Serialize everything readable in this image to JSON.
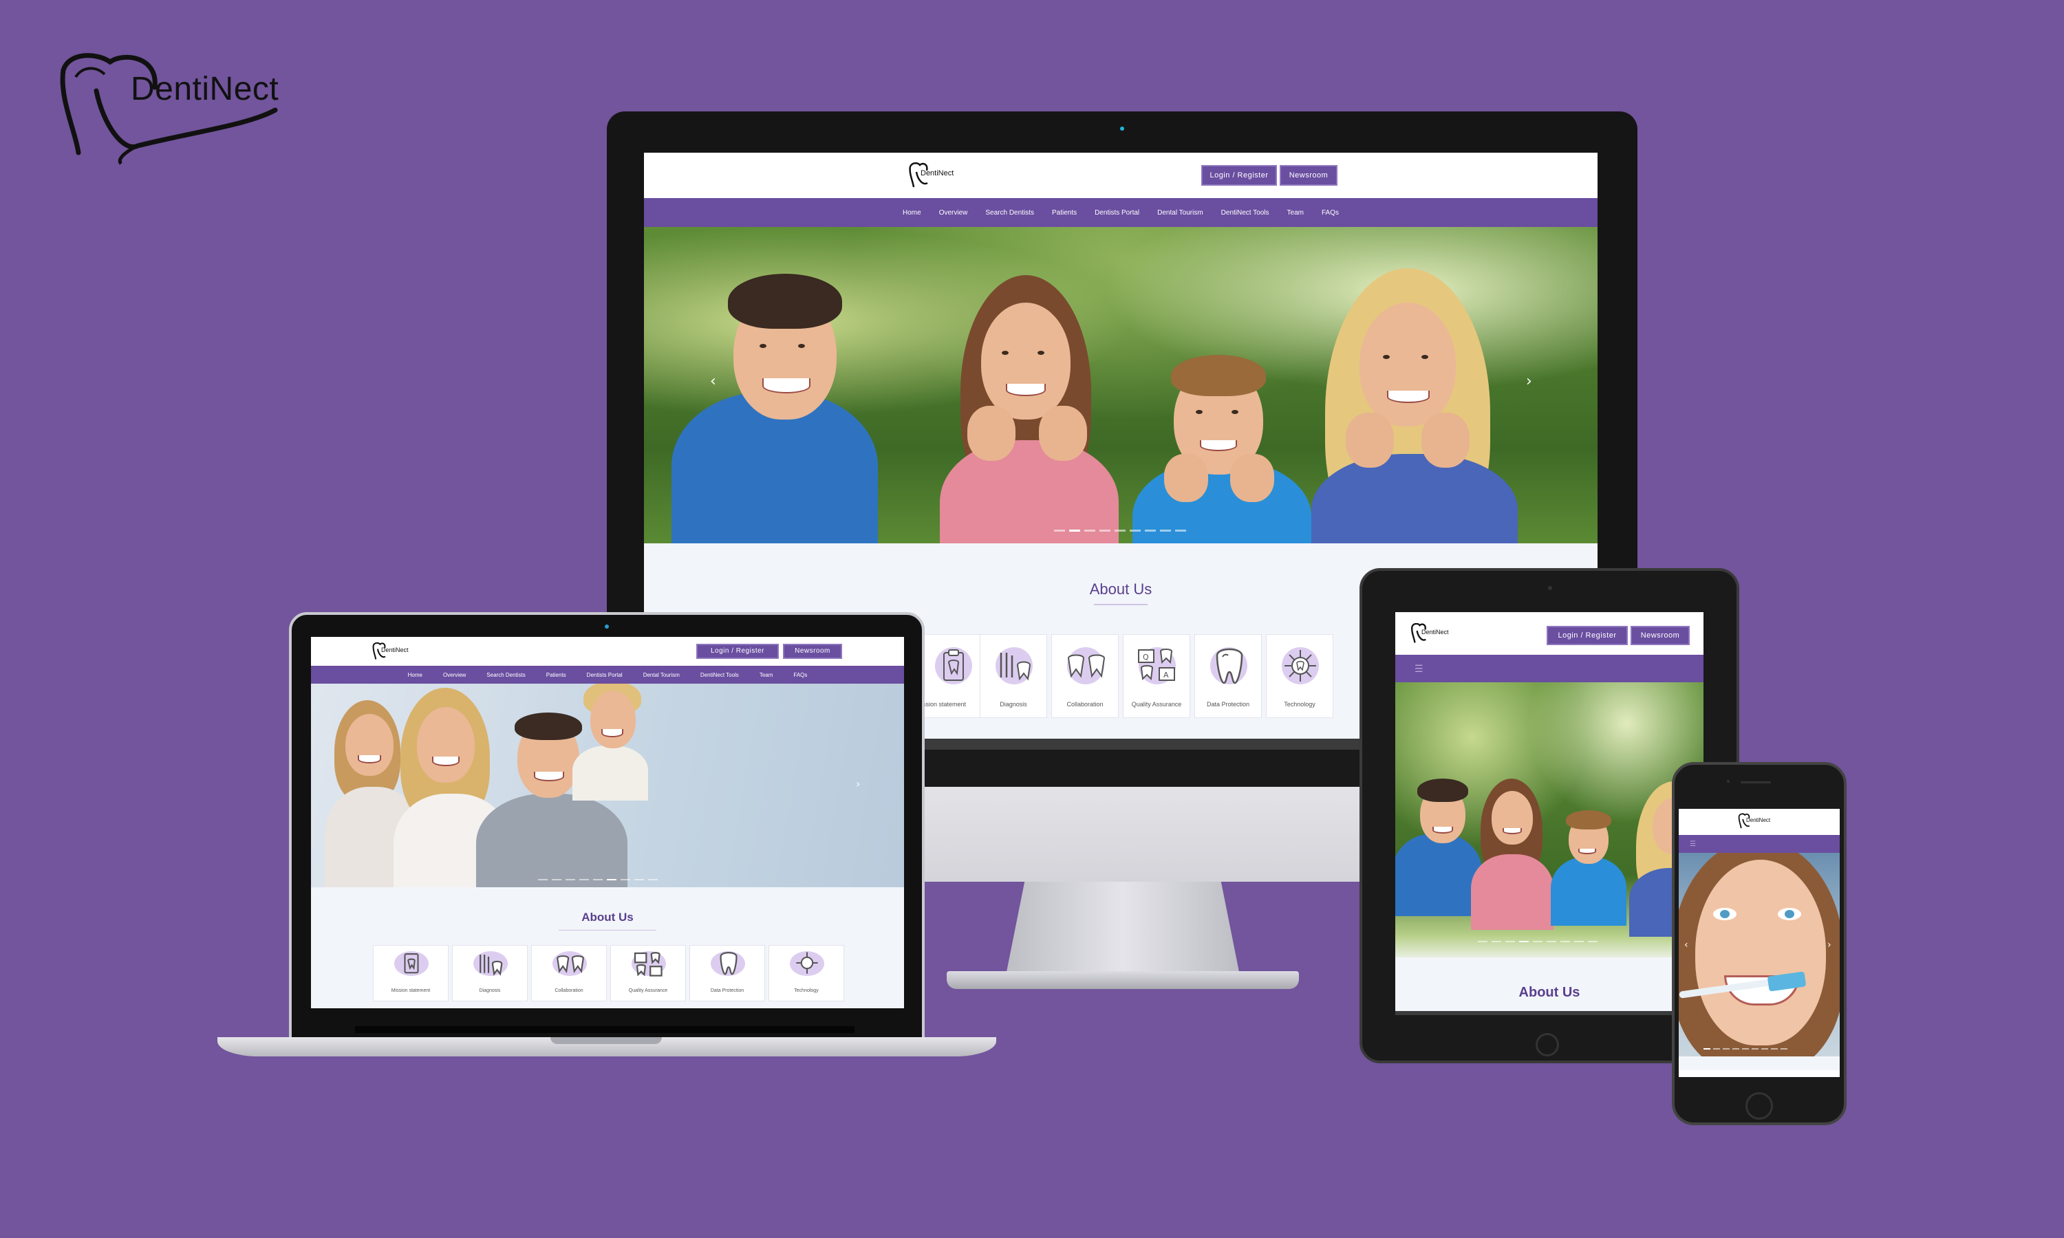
{
  "brand": {
    "name": "DentiNect"
  },
  "site": {
    "logo_text": "DentiNect",
    "login_label": "Login / Register",
    "newsroom_label": "Newsroom",
    "nav": [
      "Home",
      "Overview",
      "Search Dentists",
      "Patients",
      "Dentists Portal",
      "Dental Tourism",
      "DentiNect Tools",
      "Team",
      "FAQs"
    ],
    "about_title": "About Us",
    "features": [
      "Mission statement",
      "Diagnosis",
      "Collaboration",
      "Quality Assurance",
      "Data Protection",
      "Technology"
    ],
    "monitor_first_feature_partial": "ssion statement",
    "prev_arrow": "‹",
    "next_arrow": "›",
    "menu_icon": "☰"
  },
  "colors": {
    "background": "#72559c",
    "accent": "#6a4ea0",
    "about_title": "#5a3f8c"
  },
  "icons": [
    "tooth-logo-icon",
    "clipboard-tooth-icon",
    "dental-tools-icon",
    "teeth-pair-icon",
    "quality-qa-icon",
    "tooth-shield-icon",
    "tech-chip-icon",
    "chevron-left-icon",
    "chevron-right-icon",
    "hamburger-menu-icon"
  ]
}
